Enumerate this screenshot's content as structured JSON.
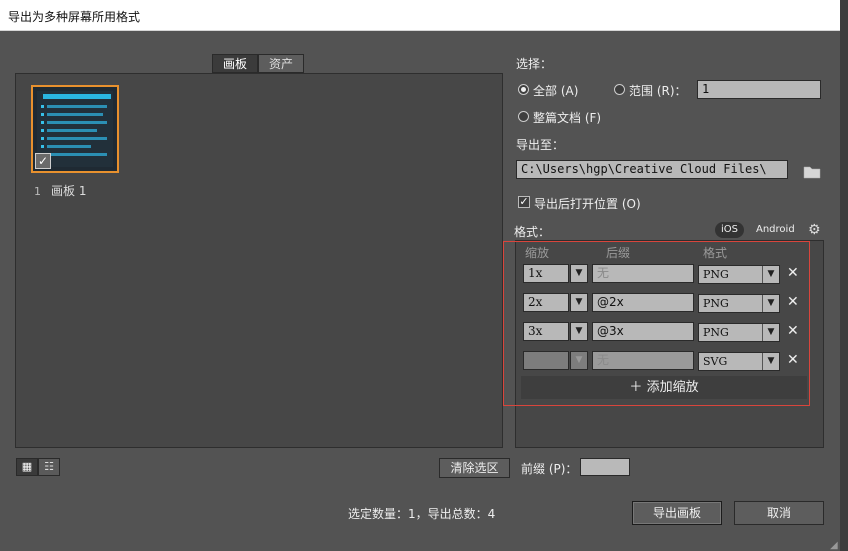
{
  "window": {
    "title": "导出为多种屏幕所用格式"
  },
  "tabs": [
    {
      "label": "画板"
    },
    {
      "label": "资产"
    }
  ],
  "artboards": [
    {
      "number": "1",
      "name": "画板 1",
      "selected": true
    }
  ],
  "view_icons": [
    "grid-view-icon",
    "list-view-icon"
  ],
  "clear_selection_label": "清除选区",
  "prefix": {
    "label": "前缀 (P)：",
    "value": ""
  },
  "status": "选定数量：1，导出总数：4",
  "select": {
    "label": "选择：",
    "all_label": "全部 (A)",
    "range_label": "范围 (R)：",
    "range_value": "1",
    "full_doc_label": "整篇文档 (F)",
    "selected_option": "all"
  },
  "export_to": {
    "label": "导出至：",
    "path": "C:\\Users\\hgp\\Creative Cloud Files\\",
    "folder_icon": "folder-icon"
  },
  "open_after": {
    "label": "导出后打开位置 (O)",
    "checked": true
  },
  "format": {
    "label": "格式：",
    "ios_label": "iOS",
    "android_label": "Android",
    "settings_icon": "gear-icon",
    "columns": {
      "scale": "缩放",
      "suffix": "后缀",
      "format": "格式"
    },
    "rows": [
      {
        "scale": "1x",
        "suffix": "",
        "suffix_placeholder": "无",
        "format": "PNG",
        "disabled": false
      },
      {
        "scale": "2x",
        "suffix": "@2x",
        "suffix_placeholder": "",
        "format": "PNG",
        "disabled": false
      },
      {
        "scale": "3x",
        "suffix": "@3x",
        "suffix_placeholder": "",
        "format": "PNG",
        "disabled": false
      },
      {
        "scale": "",
        "suffix": "",
        "suffix_placeholder": "无",
        "format": "SVG",
        "disabled": true
      }
    ],
    "add_scale_label": "添加缩放",
    "add_icon": "plus-icon",
    "remove_icon": "close-icon"
  },
  "buttons": {
    "export": "导出画板",
    "cancel": "取消"
  },
  "colors": {
    "accent_orange": "#e8912e",
    "highlight_red": "#d9453c",
    "panel": "#474747"
  }
}
